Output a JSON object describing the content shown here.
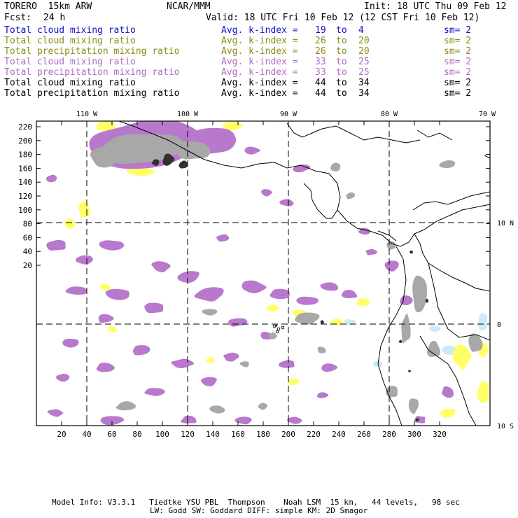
{
  "header": {
    "model": "TORERO  15km ARW",
    "center": "NCAR/MMM",
    "init": "Init: 18 UTC Thu 09 Feb 12",
    "fcst_label": "Fcst:",
    "fcst_value": "24 h",
    "valid": "Valid: 18 UTC Fri 10 Feb 12 (12 CST Fri 10 Feb 12)"
  },
  "legend_rows": [
    {
      "field": "Total cloud mixing ratio",
      "stat": "Avg. k-index =",
      "k1": "19",
      "to": "to",
      "k2": "4",
      "sm": "sm= 2",
      "color": "#1010c8"
    },
    {
      "field": "Total cloud mixing ratio",
      "stat": "Avg. k-index =",
      "k1": "26",
      "to": "to",
      "k2": "20",
      "sm": "sm= 2",
      "color": "#8c8c14"
    },
    {
      "field": "Total precipitation mixing ratio",
      "stat": "Avg. k-index =",
      "k1": "26",
      "to": "to",
      "k2": "20",
      "sm": "sm= 2",
      "color": "#8c8c14"
    },
    {
      "field": "Total cloud mixing ratio",
      "stat": "Avg. k-index =",
      "k1": "33",
      "to": "to",
      "k2": "25",
      "sm": "sm= 2",
      "color": "#b06cc0"
    },
    {
      "field": "Total precipitation mixing ratio",
      "stat": "Avg. k-index =",
      "k1": "33",
      "to": "to",
      "k2": "25",
      "sm": "sm= 2",
      "color": "#b06cc0"
    },
    {
      "field": "Total cloud mixing ratio",
      "stat": "Avg. k-index =",
      "k1": "44",
      "to": "to",
      "k2": "34",
      "sm": "sm= 2",
      "color": "#000000"
    },
    {
      "field": "Total precipitation mixing ratio",
      "stat": "Avg. k-index =",
      "k1": "44",
      "to": "to",
      "k2": "34",
      "sm": "sm= 2",
      "color": "#000000"
    }
  ],
  "map": {
    "lon_labels": [
      "110 W",
      "100 W",
      "90 W",
      "80 W",
      "70 W"
    ],
    "lat_labels": [
      "10 N",
      "0",
      "10 S"
    ],
    "x_ticks": [
      "20",
      "40",
      "60",
      "80",
      "100",
      "120",
      "140",
      "160",
      "180",
      "200",
      "220",
      "240",
      "260",
      "280",
      "300",
      "320"
    ],
    "y_ticks": [
      "220",
      "200",
      "180",
      "160",
      "140",
      "120",
      "100",
      "80",
      "60",
      "40",
      "20"
    ],
    "colors": {
      "purple": "#b878cc",
      "yellow": "#ffff66",
      "gray": "#a8a8a8",
      "dark": "#303030",
      "lightblue": "#c8ecf8"
    }
  },
  "footer": {
    "line1": "Model Info: V3.3.1   Tiedtke YSU PBL  Thompson    Noah LSM  15 km,   44 levels,   98 sec",
    "line2": "LW: Godd SW: Goddard DIFF: simple KM: 2D Smagor"
  }
}
